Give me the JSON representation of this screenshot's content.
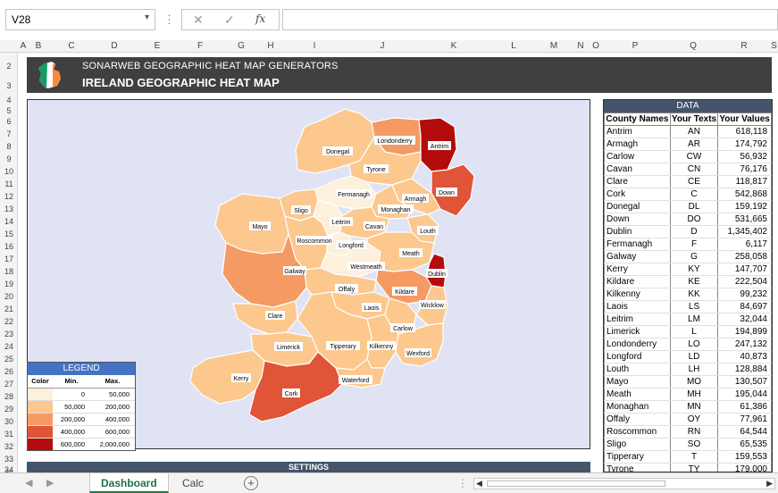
{
  "formula_bar": {
    "name_box": "V28",
    "cancel_icon": "✕",
    "confirm_icon": "✓",
    "fx_label": "fx",
    "formula": ""
  },
  "columns": [
    "A",
    "B",
    "C",
    "D",
    "E",
    "F",
    "G",
    "H",
    "I",
    "J",
    "K",
    "L",
    "M",
    "N",
    "O",
    "P",
    "Q",
    "R",
    "S"
  ],
  "rows": [
    "2",
    "3",
    "4",
    "5",
    "6",
    "7",
    "8",
    "9",
    "10",
    "11",
    "12",
    "13",
    "14",
    "15",
    "16",
    "17",
    "18",
    "19",
    "20",
    "21",
    "22",
    "23",
    "24",
    "25",
    "26",
    "27",
    "28",
    "29",
    "30",
    "31",
    "32",
    "33",
    "34",
    "35"
  ],
  "banner": {
    "subtitle": "SONARWEB GEOGRAPHIC HEAT MAP GENERATORS",
    "title": "IRELAND GEOGRAPHIC HEAT MAP"
  },
  "legend": {
    "title": "LEGEND",
    "headers": [
      "Color",
      "Min.",
      "Max."
    ],
    "bands": [
      {
        "color": "#fdf0dc",
        "min": "0",
        "max": "50,000"
      },
      {
        "color": "#fcc88e",
        "min": "50,000",
        "max": "200,000"
      },
      {
        "color": "#f59a62",
        "min": "200,000",
        "max": "400,000"
      },
      {
        "color": "#e05438",
        "min": "400,000",
        "max": "600,000"
      },
      {
        "color": "#b40c0c",
        "min": "600,000",
        "max": "2,000,000"
      }
    ]
  },
  "map_labels": {
    "antrim": "Antrim",
    "londonderry": "Londonderry",
    "donegal": "Donegal",
    "tyrone": "Tyrone",
    "down": "Down",
    "armagh": "Armagh",
    "fermanagh": "Fermanagh",
    "monaghan": "Monaghan",
    "sligo": "Sligo",
    "leitrim": "Leitrim",
    "cavan": "Cavan",
    "louth": "Louth",
    "mayo": "Mayo",
    "roscommon": "Roscommon",
    "longford": "Longford",
    "meath": "Meath",
    "westmeath": "Westmeath",
    "dublin": "Dublin",
    "galway": "Galway",
    "offaly": "Offaly",
    "kildare": "Kildare",
    "laois": "Laois",
    "wicklow": "Wicklow",
    "clare": "Clare",
    "carlow": "Carlow",
    "limerick": "Limerick",
    "tipperary": "Tipperary",
    "kilkenny": "Kilkenny",
    "wexford": "Wexford",
    "kerry": "Kerry",
    "waterford": "Waterford",
    "cork": "Cork"
  },
  "data_table": {
    "title": "DATA",
    "headers": [
      "County Names",
      "Your Texts",
      "Your Values"
    ],
    "rows": [
      [
        "Antrim",
        "AN",
        "618,118"
      ],
      [
        "Armagh",
        "AR",
        "174,792"
      ],
      [
        "Carlow",
        "CW",
        "56,932"
      ],
      [
        "Cavan",
        "CN",
        "76,176"
      ],
      [
        "Clare",
        "CE",
        "118,817"
      ],
      [
        "Cork",
        "C",
        "542,868"
      ],
      [
        "Donegal",
        "DL",
        "159,192"
      ],
      [
        "Down",
        "DO",
        "531,665"
      ],
      [
        "Dublin",
        "D",
        "1,345,402"
      ],
      [
        "Fermanagh",
        "F",
        "6,117"
      ],
      [
        "Galway",
        "G",
        "258,058"
      ],
      [
        "Kerry",
        "KY",
        "147,707"
      ],
      [
        "Kildare",
        "KE",
        "222,504"
      ],
      [
        "Kilkenny",
        "KK",
        "99,232"
      ],
      [
        "Laois",
        "LS",
        "84,697"
      ],
      [
        "Leitrim",
        "LM",
        "32,044"
      ],
      [
        "Limerick",
        "L",
        "194,899"
      ],
      [
        "Londonderry",
        "LO",
        "247,132"
      ],
      [
        "Longford",
        "LD",
        "40,873"
      ],
      [
        "Louth",
        "LH",
        "128,884"
      ],
      [
        "Mayo",
        "MO",
        "130,507"
      ],
      [
        "Meath",
        "MH",
        "195,044"
      ],
      [
        "Monaghan",
        "MN",
        "61,386"
      ],
      [
        "Offaly",
        "OY",
        "77,961"
      ],
      [
        "Roscommon",
        "RN",
        "64,544"
      ],
      [
        "Sligo",
        "SO",
        "65,535"
      ],
      [
        "Tipperary",
        "T",
        "159,553"
      ],
      [
        "Tyrone",
        "TY",
        "179,000"
      ]
    ]
  },
  "settings": {
    "title": "SETTINGS"
  },
  "sheet_tabs": {
    "tabs": [
      "Dashboard",
      "Calc"
    ],
    "active": "Dashboard",
    "add_icon": "+"
  },
  "colors": {
    "banner_bg": "#404040",
    "map_bg": "#dfe3f3",
    "legend_header": "#4472c4",
    "table_header": "#44546a",
    "active_tab": "#217346"
  }
}
